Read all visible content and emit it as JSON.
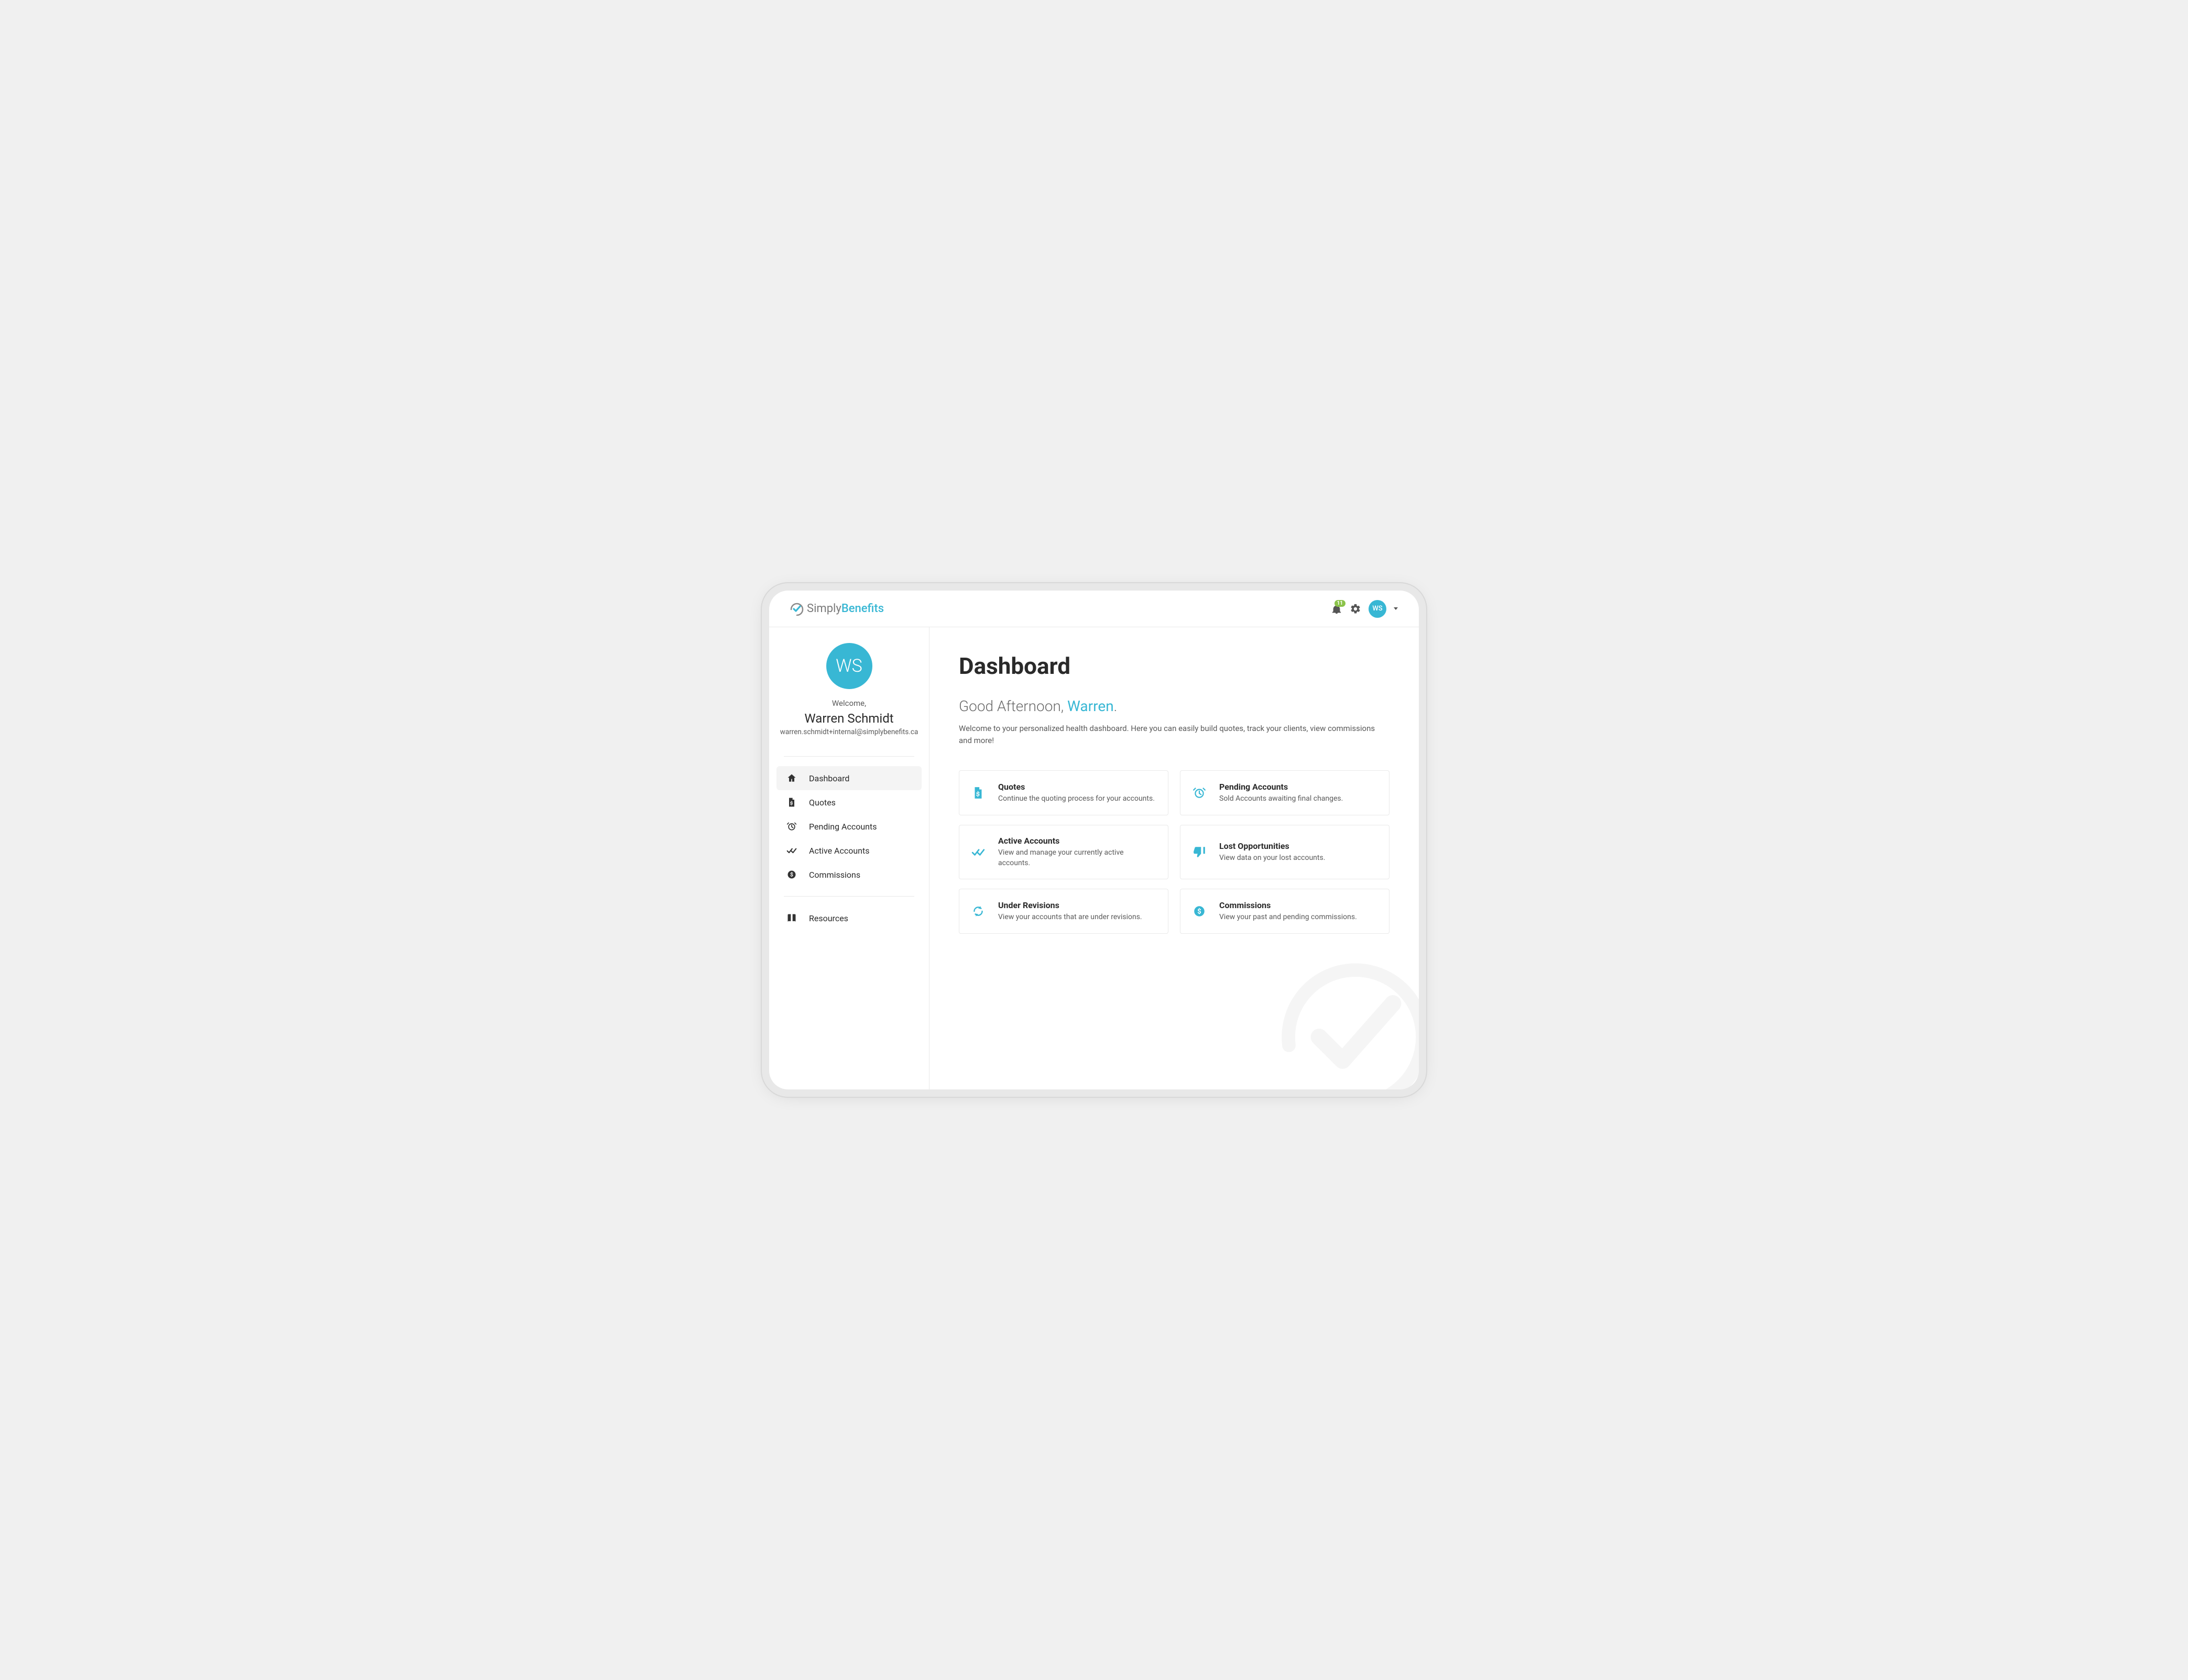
{
  "brand": {
    "part1": "Simply",
    "part2": "Benefits"
  },
  "topbar": {
    "notification_count": "11",
    "avatar_initials": "WS"
  },
  "profile": {
    "avatar_initials": "WS",
    "welcome_label": "Welcome,",
    "name": "Warren Schmidt",
    "email": "warren.schmidt+internal@simplybenefits.ca"
  },
  "nav": {
    "items": [
      {
        "label": "Dashboard",
        "icon": "home",
        "active": true
      },
      {
        "label": "Quotes",
        "icon": "file-dollar",
        "active": false
      },
      {
        "label": "Pending Accounts",
        "icon": "alarm",
        "active": false
      },
      {
        "label": "Active Accounts",
        "icon": "check-all",
        "active": false
      },
      {
        "label": "Commissions",
        "icon": "coin",
        "active": false
      }
    ],
    "secondary": [
      {
        "label": "Resources",
        "icon": "book"
      }
    ]
  },
  "main": {
    "title": "Dashboard",
    "greeting_prefix": "Good Afternoon, ",
    "greeting_name": "Warren",
    "greeting_suffix": ".",
    "subtext": "Welcome to your personalized health dashboard. Here you can easily build quotes, track your clients, view commissions and more!",
    "cards": [
      {
        "title": "Quotes",
        "desc": "Continue the quoting process for your accounts.",
        "icon": "file-dollar"
      },
      {
        "title": "Pending Accounts",
        "desc": "Sold Accounts awaiting final changes.",
        "icon": "alarm"
      },
      {
        "title": "Active Accounts",
        "desc": "View and manage your currently active accounts.",
        "icon": "check-all"
      },
      {
        "title": "Lost Opportunities",
        "desc": "View data on your lost accounts.",
        "icon": "thumb-down"
      },
      {
        "title": "Under Revisions",
        "desc": "View your accounts that are under revisions.",
        "icon": "refresh"
      },
      {
        "title": "Commissions",
        "desc": "View your past and pending commissions.",
        "icon": "coin"
      }
    ]
  }
}
